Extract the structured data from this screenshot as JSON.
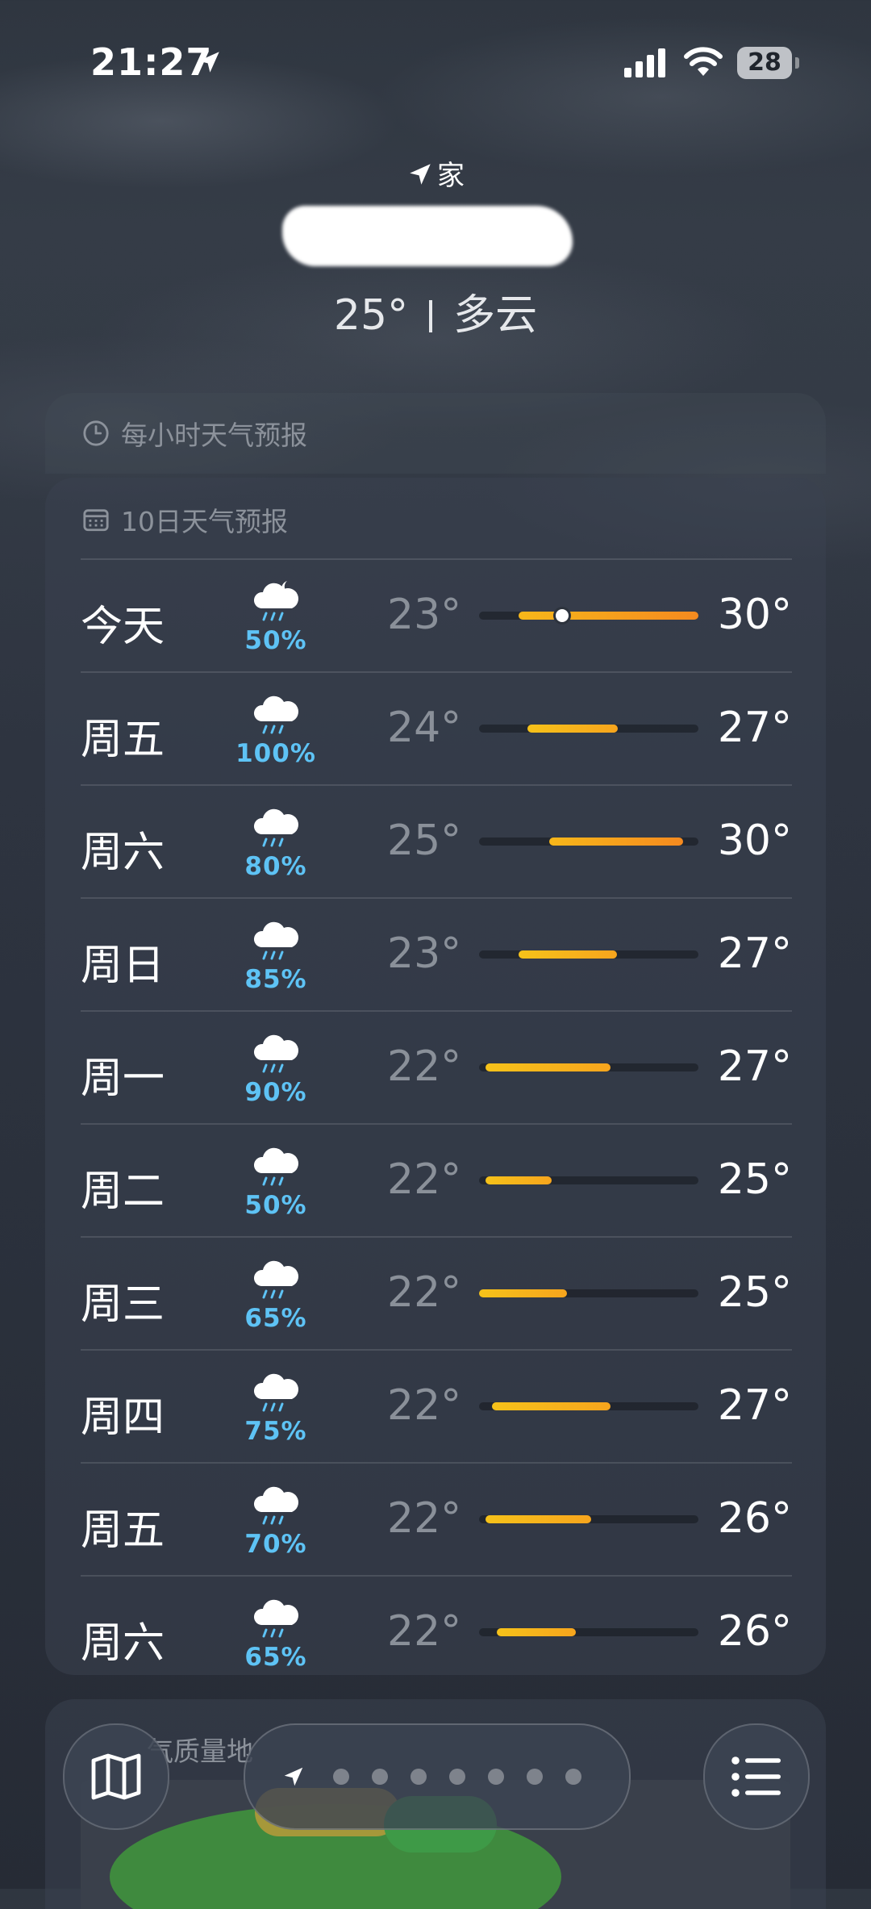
{
  "status": {
    "time": "21:27",
    "battery": "28"
  },
  "header": {
    "location_label": "家",
    "current_temp": "25°",
    "condition": "多云"
  },
  "hourly": {
    "title": "每小时天气预报"
  },
  "daily": {
    "title": "10日天气预报",
    "days": [
      {
        "day": "今天",
        "icon": "cloud-moon-rain-icon",
        "prob": "50%",
        "low": "23°",
        "high": "30°",
        "bar_start": 0.18,
        "bar_end": 1.0,
        "current_pos": 0.38
      },
      {
        "day": "周五",
        "icon": "cloud-rain-icon",
        "prob": "100%",
        "low": "24°",
        "high": "27°",
        "bar_start": 0.22,
        "bar_end": 0.63
      },
      {
        "day": "周六",
        "icon": "cloud-rain-icon",
        "prob": "80%",
        "low": "25°",
        "high": "30°",
        "bar_start": 0.32,
        "bar_end": 0.93
      },
      {
        "day": "周日",
        "icon": "cloud-rain-icon",
        "prob": "85%",
        "low": "23°",
        "high": "27°",
        "bar_start": 0.18,
        "bar_end": 0.63
      },
      {
        "day": "周一",
        "icon": "cloud-rain-icon",
        "prob": "90%",
        "low": "22°",
        "high": "27°",
        "bar_start": 0.03,
        "bar_end": 0.6
      },
      {
        "day": "周二",
        "icon": "cloud-rain-icon",
        "prob": "50%",
        "low": "22°",
        "high": "25°",
        "bar_start": 0.03,
        "bar_end": 0.33
      },
      {
        "day": "周三",
        "icon": "cloud-rain-icon",
        "prob": "65%",
        "low": "22°",
        "high": "25°",
        "bar_start": 0.0,
        "bar_end": 0.4
      },
      {
        "day": "周四",
        "icon": "cloud-rain-icon",
        "prob": "75%",
        "low": "22°",
        "high": "27°",
        "bar_start": 0.06,
        "bar_end": 0.6
      },
      {
        "day": "周五",
        "icon": "cloud-rain-icon",
        "prob": "70%",
        "low": "22°",
        "high": "26°",
        "bar_start": 0.03,
        "bar_end": 0.51
      },
      {
        "day": "周六",
        "icon": "cloud-rain-icon",
        "prob": "65%",
        "low": "22°",
        "high": "26°",
        "bar_start": 0.08,
        "bar_end": 0.44
      }
    ]
  },
  "air_quality": {
    "title_visible": "气质量地"
  },
  "nav": {
    "page_dots": 7
  }
}
